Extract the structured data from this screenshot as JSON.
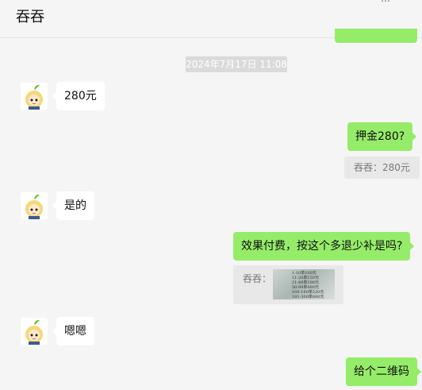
{
  "header": {
    "title": "吞吞",
    "more_icon": "more-icon"
  },
  "timestamp": "2024年7月17日 11:08",
  "messages": [
    {
      "side": "left",
      "text": "280元"
    },
    {
      "side": "right",
      "text": "押金280?"
    },
    {
      "side": "right",
      "quote": "吞吞：280元"
    },
    {
      "side": "left",
      "text": "是的"
    },
    {
      "side": "right",
      "text": "效果付费，按这个多退少补是吗?"
    },
    {
      "side": "right",
      "quote_label": "吞吞：",
      "quote_image_lines": [
        "1-10单100元",
        "11-20单150元",
        "21-49单288元",
        "50-99单480元",
        "100-180单520元",
        "181-300单800元"
      ]
    },
    {
      "side": "left",
      "text": "嗯嗯"
    },
    {
      "side": "right",
      "text": "给个二维码"
    }
  ],
  "colors": {
    "self_bubble": "#95ec69",
    "other_bubble": "#ffffff",
    "background": "#f5f5f5",
    "quote_bg": "#e8e8e8"
  }
}
